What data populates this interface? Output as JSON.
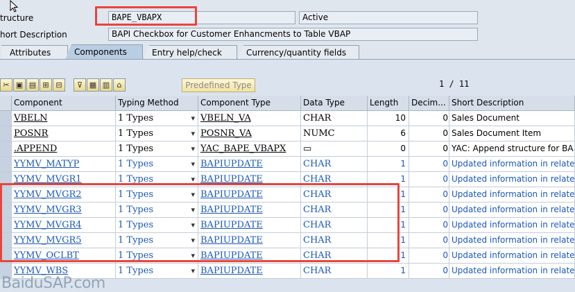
{
  "header": {
    "structure_label": "tructure",
    "structure_value": "BAPE_VBAPX",
    "status": "Active",
    "short_desc_label": "hort Description",
    "short_desc_value": "BAPI Checkbox for Customer Enhancments to Table VBAP"
  },
  "tabs": [
    {
      "label": "Attributes",
      "active": false
    },
    {
      "label": "Components",
      "active": true
    },
    {
      "label": "Entry help/check",
      "active": false
    },
    {
      "label": "Currency/quantity fields",
      "active": false
    }
  ],
  "toolbar": {
    "predefined_label": "Predefined Type",
    "pager": "1 / 11"
  },
  "columns": [
    "Component",
    "Typing Method",
    "Component Type",
    "Data Type",
    "Length",
    "Decim...",
    "Short Description"
  ],
  "rows": [
    {
      "component": "VBELN",
      "typing": "1 Types",
      "ctype": "VBELN_VA",
      "dtype": "CHAR",
      "length": "10",
      "dec": "0",
      "desc": "Sales Document",
      "blue": false
    },
    {
      "component": "POSNR",
      "typing": "1 Types",
      "ctype": "POSNR_VA",
      "dtype": "NUMC",
      "length": "6",
      "dec": "0",
      "desc": "Sales Document Item",
      "blue": false
    },
    {
      "component": ".APPEND",
      "typing": "1 Types",
      "ctype": "YAC_BAPE_VBAPX",
      "dtype": "▭",
      "length": "0",
      "dec": "0",
      "desc": "YAC: Append structure for BA",
      "blue": false
    },
    {
      "component": "YYMV_MATYP",
      "typing": "1 Types",
      "ctype": "BAPIUPDATE",
      "dtype": "CHAR",
      "length": "1",
      "dec": "0",
      "desc": "Updated information in relate",
      "blue": true
    },
    {
      "component": "YYMV_MVGR1",
      "typing": "1 Types",
      "ctype": "BAPIUPDATE",
      "dtype": "CHAR",
      "length": "1",
      "dec": "0",
      "desc": "Updated information in relate",
      "blue": true
    },
    {
      "component": "YYMV_MVGR2",
      "typing": "1 Types",
      "ctype": "BAPIUPDATE",
      "dtype": "CHAR",
      "length": "1",
      "dec": "0",
      "desc": "Updated information in relate",
      "blue": true
    },
    {
      "component": "YYMV_MVGR3",
      "typing": "1 Types",
      "ctype": "BAPIUPDATE",
      "dtype": "CHAR",
      "length": "1",
      "dec": "0",
      "desc": "Updated information in relate",
      "blue": true
    },
    {
      "component": "YYMV_MVGR4",
      "typing": "1 Types",
      "ctype": "BAPIUPDATE",
      "dtype": "CHAR",
      "length": "1",
      "dec": "0",
      "desc": "Updated information in relate",
      "blue": true
    },
    {
      "component": "YYMV_MVGR5",
      "typing": "1 Types",
      "ctype": "BAPIUPDATE",
      "dtype": "CHAR",
      "length": "1",
      "dec": "0",
      "desc": "Updated information in relate",
      "blue": true
    },
    {
      "component": "YYMV_OCLBT",
      "typing": "1 Types",
      "ctype": "BAPIUPDATE",
      "dtype": "CHAR",
      "length": "1",
      "dec": "0",
      "desc": "Updated information in relate",
      "blue": true
    },
    {
      "component": "YYMV_WBS",
      "typing": "1 Types",
      "ctype": "BAPIUPDATE",
      "dtype": "CHAR",
      "length": "1",
      "dec": "0",
      "desc": "Updated information in relate",
      "blue": true
    }
  ],
  "watermark": "BaiduSAP.com",
  "colors": {
    "highlight": "#e8453c",
    "link_blue": "#1a58b8"
  }
}
